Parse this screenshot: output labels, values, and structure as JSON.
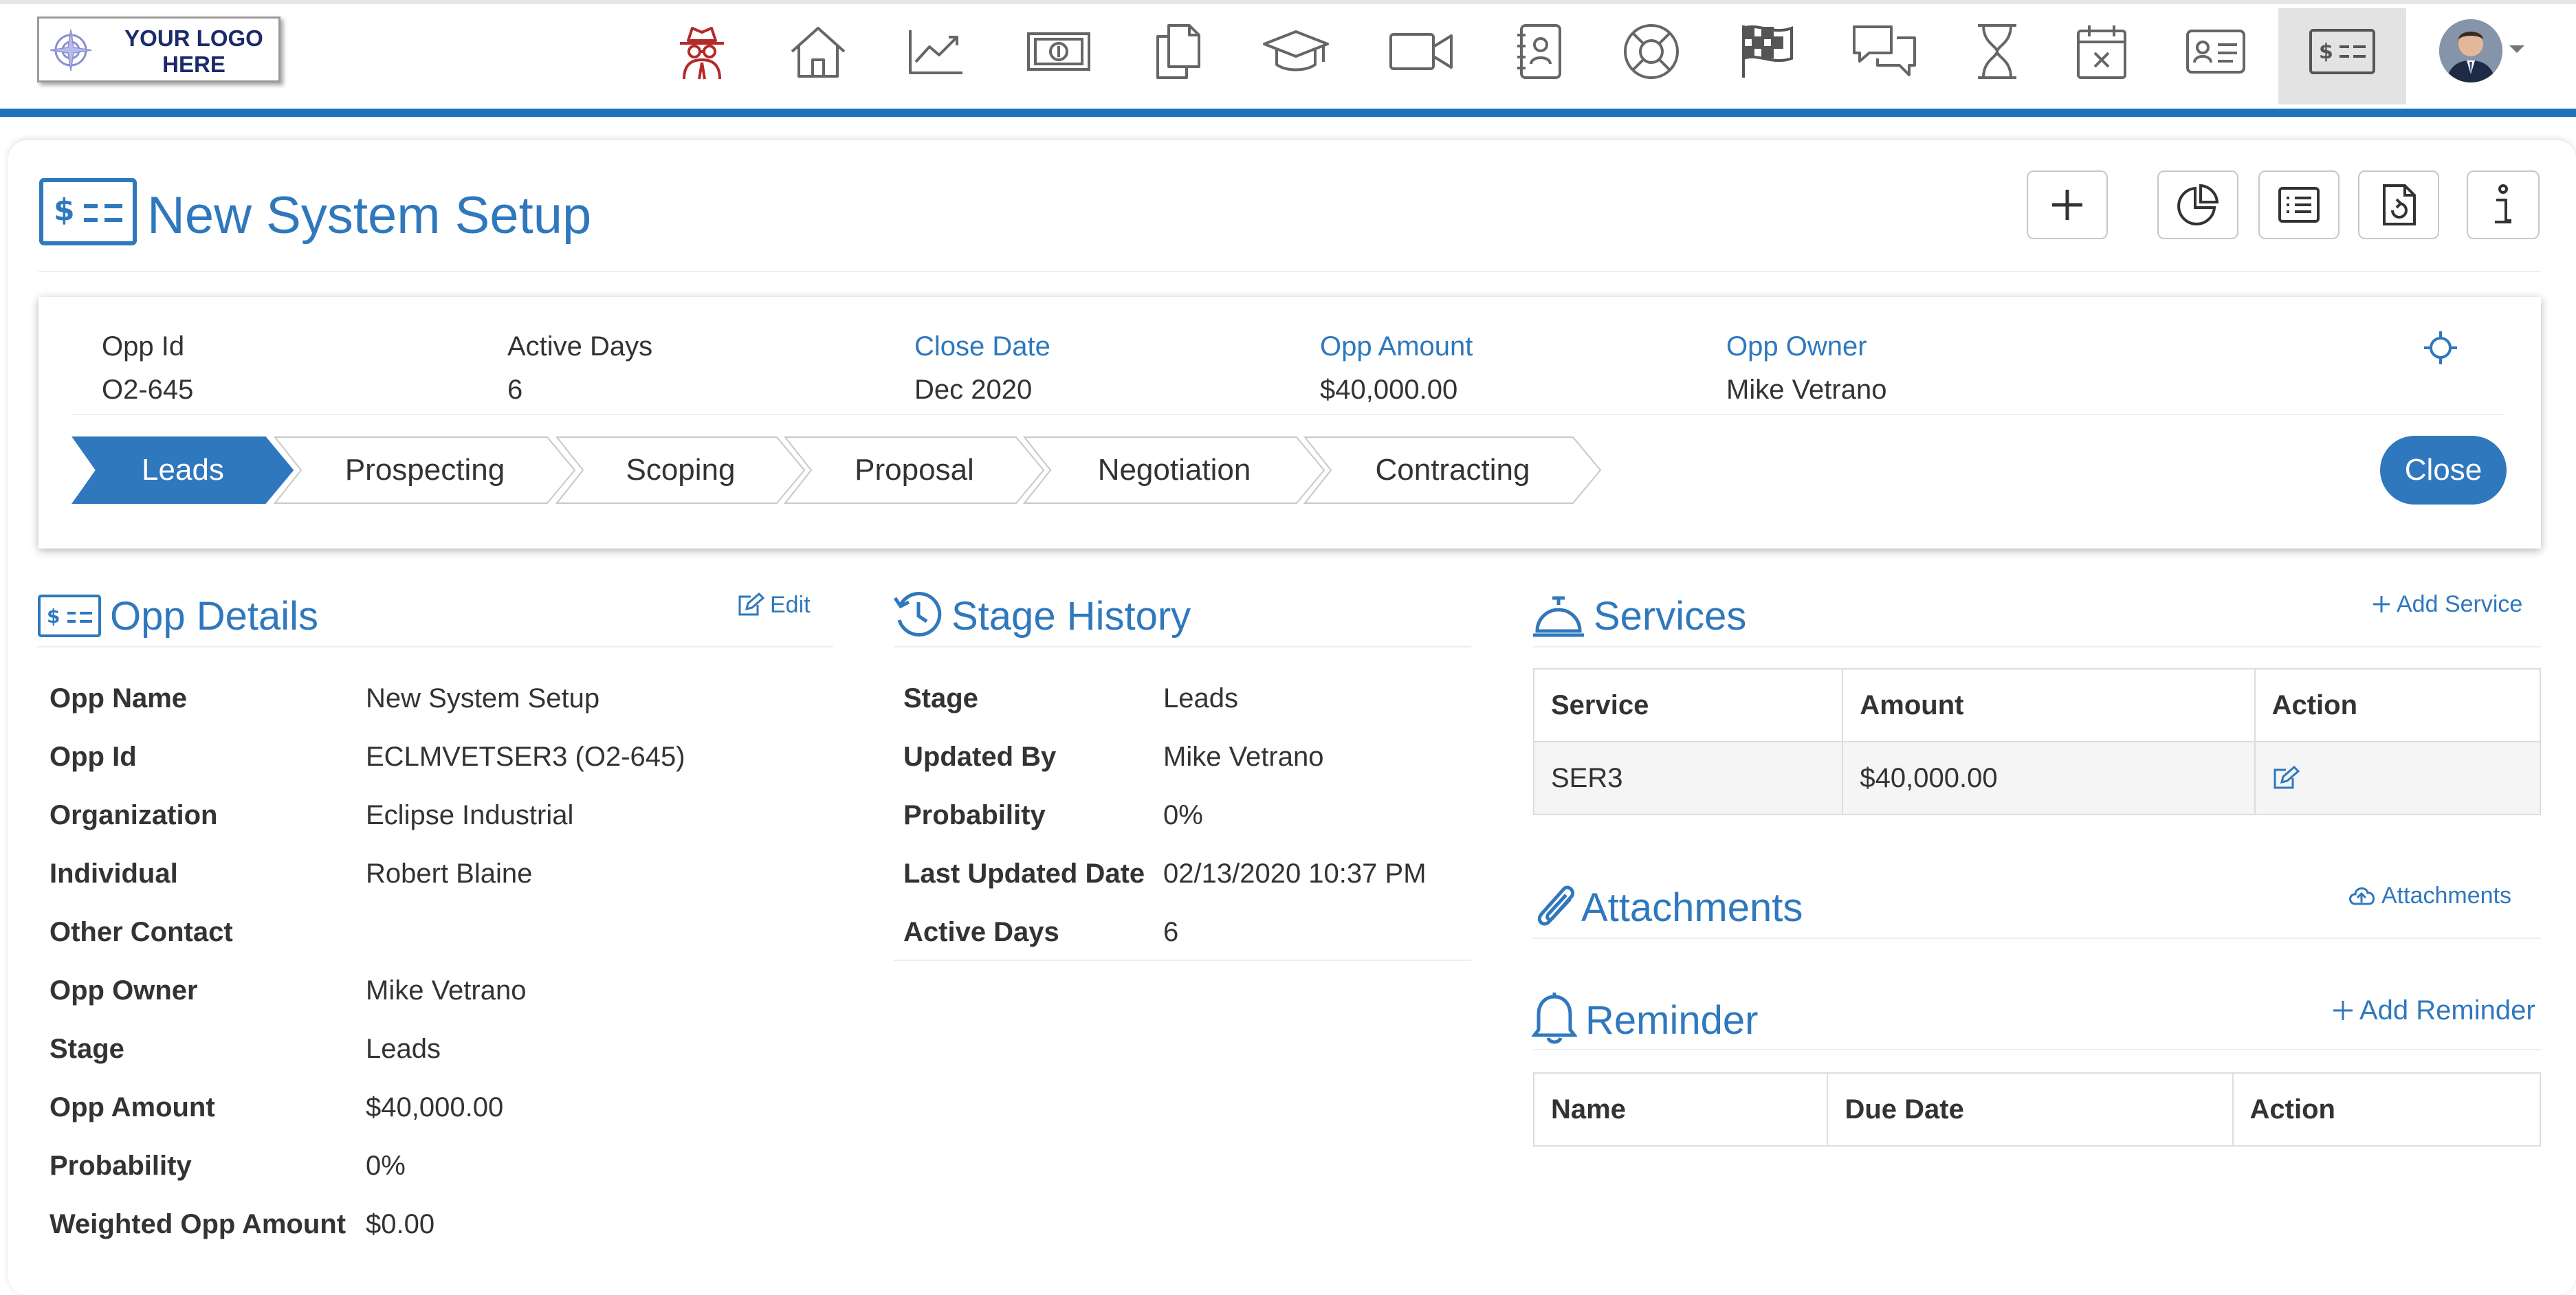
{
  "logo": {
    "line1": "YOUR LOGO",
    "line2": "HERE"
  },
  "nav": {
    "icons": [
      "spy-icon",
      "home-icon",
      "trend-chart-icon",
      "money-icon",
      "copy-icon",
      "graduation-cap-icon",
      "video-camera-icon",
      "contact-book-icon",
      "lifebuoy-icon",
      "checkered-flag-icon",
      "chat-bubbles-icon",
      "hourglass-icon",
      "calendar-x-icon",
      "id-card-icon",
      "dollar-card-icon"
    ],
    "active_icon": "dollar-card-icon"
  },
  "page": {
    "title": "New System Setup"
  },
  "toolbar": {
    "icons": [
      "plus-icon",
      "pie-chart-icon",
      "list-icon",
      "file-refresh-icon",
      "info-icon"
    ]
  },
  "summary": {
    "fields": [
      {
        "label": "Opp Id",
        "value": "O2-645",
        "label_color": "#333333"
      },
      {
        "label": "Active Days",
        "value": "6",
        "label_color": "#333333"
      },
      {
        "label": "Close Date",
        "value": "Dec 2020",
        "label_color": "#2f78bd"
      },
      {
        "label": "Opp Amount",
        "value": "$40,000.00",
        "label_color": "#2f78bd"
      },
      {
        "label": "Opp Owner",
        "value": "Mike Vetrano",
        "label_color": "#2f78bd"
      }
    ]
  },
  "stages": {
    "items": [
      "Leads",
      "Prospecting",
      "Scoping",
      "Proposal",
      "Negotiation",
      "Contracting"
    ],
    "active": "Leads",
    "close_label": "Close"
  },
  "opp_details": {
    "title": "Opp Details",
    "edit_label": "Edit",
    "rows": [
      {
        "label": "Opp Name",
        "value": "New System Setup"
      },
      {
        "label": "Opp Id",
        "value": "ECLMVETSER3 (O2-645)"
      },
      {
        "label": "Organization",
        "value": "Eclipse Industrial"
      },
      {
        "label": "Individual",
        "value": "Robert Blaine"
      },
      {
        "label": "Other Contact",
        "value": ""
      },
      {
        "label": "Opp Owner",
        "value": "Mike Vetrano"
      },
      {
        "label": "Stage",
        "value": "Leads"
      },
      {
        "label": "Opp Amount",
        "value": "$40,000.00"
      },
      {
        "label": "Probability",
        "value": "0%"
      },
      {
        "label": "Weighted Opp Amount",
        "value": "$0.00"
      }
    ]
  },
  "stage_history": {
    "title": "Stage History",
    "rows": [
      {
        "label": "Stage",
        "value": "Leads"
      },
      {
        "label": "Updated By",
        "value": "Mike Vetrano"
      },
      {
        "label": "Probability",
        "value": "0%"
      },
      {
        "label": "Last Updated Date",
        "value": "02/13/2020 10:37 PM"
      },
      {
        "label": "Active Days",
        "value": "6"
      }
    ]
  },
  "services": {
    "title": "Services",
    "add_label": "Add Service",
    "columns": [
      "Service",
      "Amount",
      "Action"
    ],
    "rows": [
      {
        "service": "SER3",
        "amount": "$40,000.00"
      }
    ]
  },
  "attachments": {
    "title": "Attachments",
    "link_label": "Attachments"
  },
  "reminder": {
    "title": "Reminder",
    "add_label": "Add Reminder",
    "columns": [
      "Name",
      "Due Date",
      "Action"
    ]
  },
  "colors": {
    "accent": "#2f78bd",
    "nav_bar": "#1f73bd",
    "spy_icon": "#b52a2a"
  }
}
